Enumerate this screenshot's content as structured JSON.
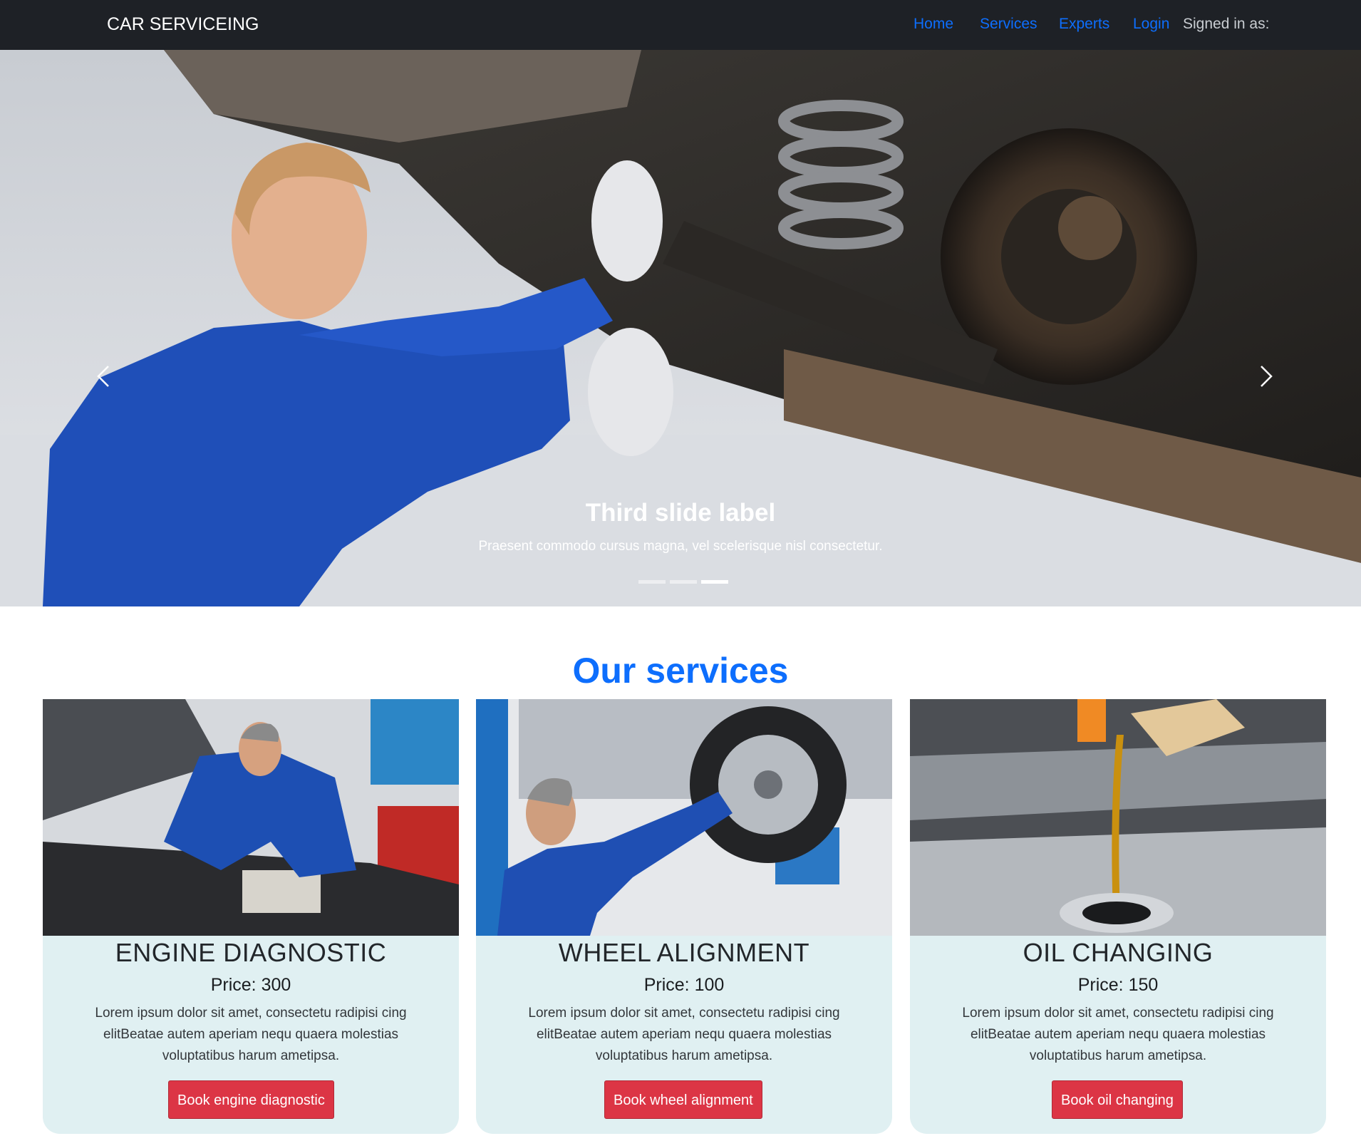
{
  "navbar": {
    "brand": "CAR SERVICEING",
    "links": [
      "Home",
      "Services",
      "Experts",
      "Login"
    ],
    "signed_in": "Signed in as:"
  },
  "carousel": {
    "caption_title": "Third slide label",
    "caption_text": "Praesent commodo cursus magna, vel scelerisque nisl consectetur.",
    "slide_count": 3,
    "active_slide": 3
  },
  "services": {
    "heading": "Our services",
    "items": [
      {
        "title": "ENGINE DIAGNOSTIC",
        "price": "Price: 300",
        "description": "Lorem ipsum dolor sit amet, consectetu radipisi cing elitBeatae autem aperiam nequ quaera molestias voluptatibus harum ametipsa.",
        "button": "Book engine diagnostic"
      },
      {
        "title": "WHEEL ALIGNMENT",
        "price": "Price: 100",
        "description": "Lorem ipsum dolor sit amet, consectetu radipisi cing elitBeatae autem aperiam nequ quaera molestias voluptatibus harum ametipsa.",
        "button": "Book wheel alignment"
      },
      {
        "title": "OIL CHANGING",
        "price": "Price: 150",
        "description": "Lorem ipsum dolor sit amet, consectetu radipisi cing elitBeatae autem aperiam nequ quaera molestias voluptatibus harum ametipsa.",
        "button": "Book oil changing"
      }
    ]
  },
  "colors": {
    "navbar_bg": "#1e2126",
    "link": "#0d6efd",
    "heading": "#0d6efd",
    "card_bg": "#e0f0f2",
    "button": "#dc3545"
  },
  "icons": {
    "prev": "chevron-left-icon",
    "next": "chevron-right-icon"
  }
}
